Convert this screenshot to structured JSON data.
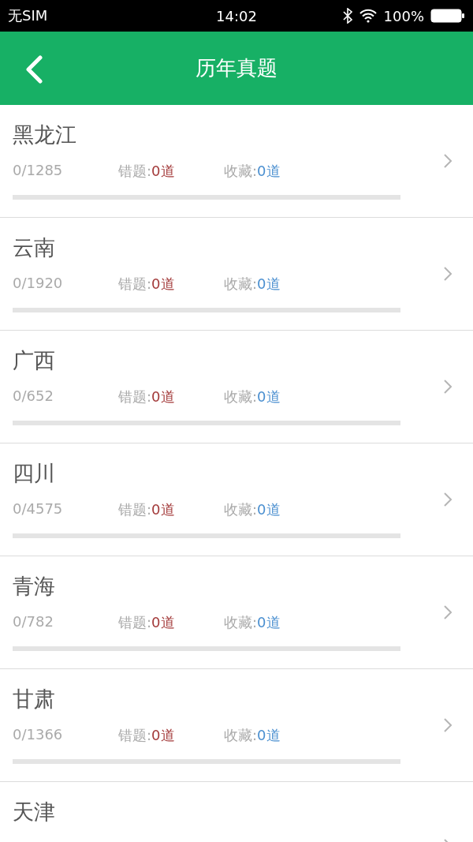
{
  "status_bar": {
    "carrier": "无SIM",
    "time": "14:02",
    "battery": "100%"
  },
  "nav_bar": {
    "title": "历年真题"
  },
  "papers": [
    {
      "name": "黑龙江",
      "progress": "0/1285",
      "wrong_label": "错题:",
      "wrong": "0道",
      "fav_label": "收藏:",
      "fav": "0道",
      "level": 0
    },
    {
      "name": "云南",
      "progress": "0/1920",
      "wrong_label": "错题:",
      "wrong": "0道",
      "fav_label": "收藏:",
      "fav": "0道",
      "level": 0
    },
    {
      "name": "广西",
      "progress": "0/652",
      "wrong_label": "错题:",
      "wrong": "0道",
      "fav_label": "收藏:",
      "fav": "0道",
      "level": 0
    },
    {
      "name": "四川",
      "progress": "0/4575",
      "wrong_label": "错题:",
      "wrong": "0道",
      "fav_label": "收藏:",
      "fav": "0道",
      "level": 0
    },
    {
      "name": "青海",
      "progress": "0/782",
      "wrong_label": "错题:",
      "wrong": "0道",
      "fav_label": "收藏:",
      "fav": "0道",
      "level": 0
    },
    {
      "name": "甘肃",
      "progress": "0/1366",
      "wrong_label": "错题:",
      "wrong": "0道",
      "fav_label": "收藏:",
      "fav": "0道",
      "level": 0
    },
    {
      "name": "天津"
    }
  ]
}
